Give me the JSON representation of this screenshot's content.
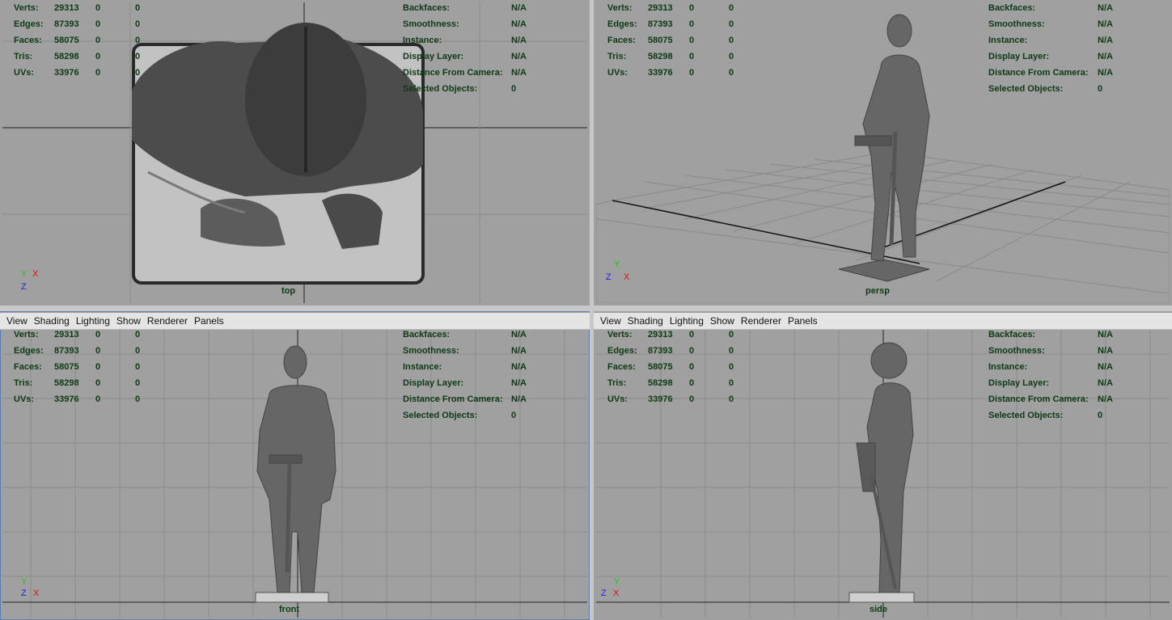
{
  "menu": [
    "View",
    "Shading",
    "Lighting",
    "Show",
    "Renderer",
    "Panels"
  ],
  "stats": [
    {
      "label": "Verts:",
      "value": "29313",
      "a": "0",
      "b": "0"
    },
    {
      "label": "Edges:",
      "value": "87393",
      "a": "0",
      "b": "0"
    },
    {
      "label": "Faces:",
      "value": "58075",
      "a": "0",
      "b": "0"
    },
    {
      "label": "Tris:",
      "value": "58298",
      "a": "0",
      "b": "0"
    },
    {
      "label": "UVs:",
      "value": "33976",
      "a": "0",
      "b": "0"
    }
  ],
  "info": [
    {
      "label": "Backfaces:",
      "value": "N/A"
    },
    {
      "label": "Smoothness:",
      "value": "N/A"
    },
    {
      "label": "Instance:",
      "value": "N/A"
    },
    {
      "label": "Display Layer:",
      "value": "N/A"
    },
    {
      "label": "Distance From Camera:",
      "value": "N/A"
    },
    {
      "label": "Selected Objects:",
      "value": "0"
    }
  ],
  "cameras": {
    "top": "top",
    "persp": "persp",
    "front": "front",
    "side": "side"
  },
  "axes": {
    "top": [
      "Y",
      "X",
      "Z"
    ],
    "persp": [
      "Y",
      "Z",
      "X"
    ],
    "front": [
      "Y",
      "Z",
      "X"
    ],
    "side": [
      "Y",
      "Z",
      "X"
    ]
  },
  "colors": {
    "viewport_bg": "#a0a0a0",
    "hud_text": "#0d3a14",
    "axis_x": "#d11",
    "axis_y": "#1c1",
    "axis_z": "#22d",
    "menubar": "#e4e4e4",
    "selected_border": "#5a7fb0"
  }
}
